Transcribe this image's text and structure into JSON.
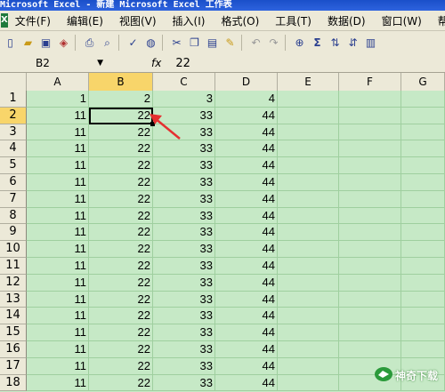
{
  "window": {
    "title": "Microsoft Excel - 新建 Microsoft Excel 工作表"
  },
  "menu": [
    "文件(F)",
    "编辑(E)",
    "视图(V)",
    "插入(I)",
    "格式(O)",
    "工具(T)",
    "数据(D)",
    "窗口(W)",
    "帮助"
  ],
  "formula": {
    "cell_ref": "B2",
    "fx": "fx",
    "value": "22"
  },
  "columns": [
    "A",
    "B",
    "C",
    "D",
    "E",
    "F",
    "G"
  ],
  "rows": [
    {
      "num": "1",
      "a": "1",
      "b": "2",
      "c": "3",
      "d": "4"
    },
    {
      "num": "2",
      "a": "11",
      "b": "22",
      "c": "33",
      "d": "44"
    },
    {
      "num": "3",
      "a": "11",
      "b": "22",
      "c": "33",
      "d": "44"
    },
    {
      "num": "4",
      "a": "11",
      "b": "22",
      "c": "33",
      "d": "44"
    },
    {
      "num": "5",
      "a": "11",
      "b": "22",
      "c": "33",
      "d": "44"
    },
    {
      "num": "6",
      "a": "11",
      "b": "22",
      "c": "33",
      "d": "44"
    },
    {
      "num": "7",
      "a": "11",
      "b": "22",
      "c": "33",
      "d": "44"
    },
    {
      "num": "8",
      "a": "11",
      "b": "22",
      "c": "33",
      "d": "44"
    },
    {
      "num": "9",
      "a": "11",
      "b": "22",
      "c": "33",
      "d": "44"
    },
    {
      "num": "10",
      "a": "11",
      "b": "22",
      "c": "33",
      "d": "44"
    },
    {
      "num": "11",
      "a": "11",
      "b": "22",
      "c": "33",
      "d": "44"
    },
    {
      "num": "12",
      "a": "11",
      "b": "22",
      "c": "33",
      "d": "44"
    },
    {
      "num": "13",
      "a": "11",
      "b": "22",
      "c": "33",
      "d": "44"
    },
    {
      "num": "14",
      "a": "11",
      "b": "22",
      "c": "33",
      "d": "44"
    },
    {
      "num": "15",
      "a": "11",
      "b": "22",
      "c": "33",
      "d": "44"
    },
    {
      "num": "16",
      "a": "11",
      "b": "22",
      "c": "33",
      "d": "44"
    },
    {
      "num": "17",
      "a": "11",
      "b": "22",
      "c": "33",
      "d": "44"
    },
    {
      "num": "18",
      "a": "11",
      "b": "22",
      "c": "33",
      "d": "44"
    }
  ],
  "watermark": {
    "text": "神奇下载"
  },
  "colors": {
    "sheet_bg": "#c6e9c6",
    "header_active": "#f8d56a",
    "title_bar": "#1a4fc9",
    "arrow": "#e53030"
  }
}
